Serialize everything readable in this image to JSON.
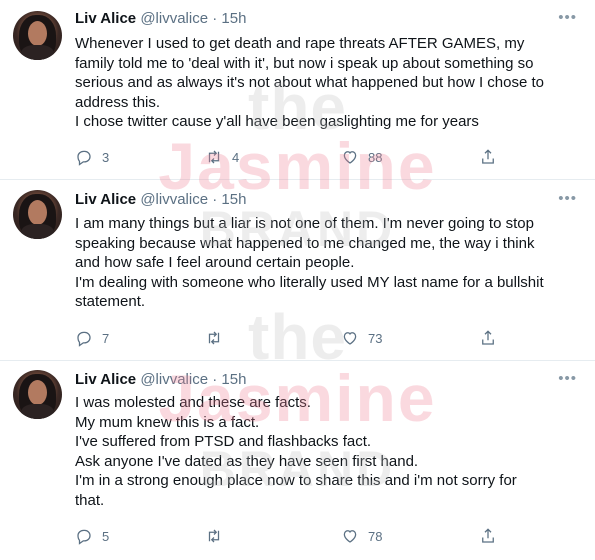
{
  "tweets": [
    {
      "name": "Liv Alice",
      "handle": "@livvalice",
      "time": "15h",
      "lines": [
        "Whenever I used to get death and rape threats AFTER GAMES, my",
        "family told me to 'deal with it', but now i speak up about something so",
        "serious and as always it's not about what happened but how I chose to",
        "address this.",
        "I chose twitter cause y'all have been gaslighting me for years"
      ],
      "replies": "3",
      "retweets": "4",
      "likes": "88"
    },
    {
      "name": "Liv Alice",
      "handle": "@livvalice",
      "time": "15h",
      "lines": [
        "I am many things but a liar is not one of them. I'm never going to stop",
        "speaking because what happened to me changed me, the way i think",
        "and how safe I feel around certain people.",
        "I'm dealing with someone who literally used MY last name for a bullshit",
        "statement."
      ],
      "replies": "7",
      "retweets": "",
      "likes": "73"
    },
    {
      "name": "Liv Alice",
      "handle": "@livvalice",
      "time": "15h",
      "lines": [
        "I was molested and these are facts.",
        "My mum knew this is a fact.",
        "I've suffered from PTSD and flashbacks fact.",
        "Ask anyone I've dated as they have seen first hand.",
        "I'm in a strong enough place now to share this and i'm not sorry for",
        "that."
      ],
      "replies": "5",
      "retweets": "",
      "likes": "78"
    }
  ],
  "watermark": {
    "top": [
      "the",
      "Jasmine",
      "BRAND"
    ],
    "bottom": [
      "the",
      "Jasmine",
      "BRAND"
    ]
  },
  "separator": "·",
  "more_glyph": "•••",
  "icons": [
    "reply-icon",
    "retweet-icon",
    "like-icon",
    "share-icon",
    "more-icon"
  ],
  "colors": {
    "text": "#0f1419",
    "secondary": "#5b7083",
    "divider": "#e6ecf0",
    "watermark_pink": "#f08296"
  }
}
